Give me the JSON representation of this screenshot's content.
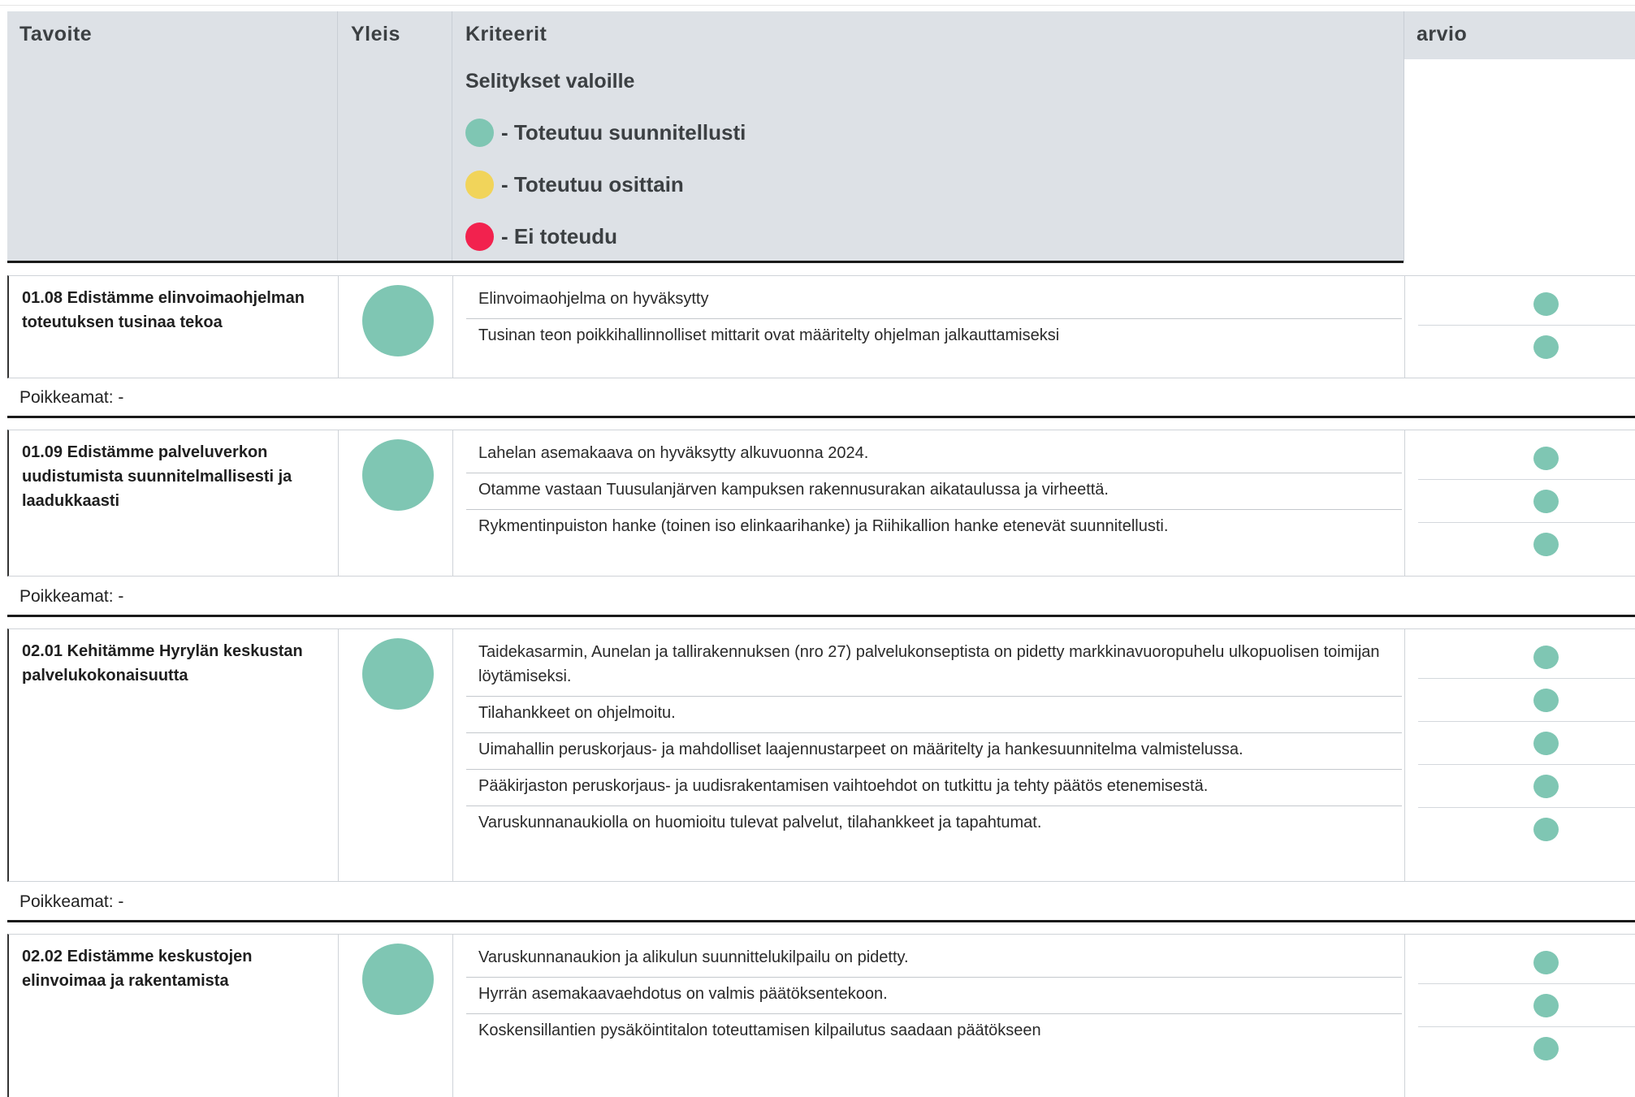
{
  "colors": {
    "green": "#7fc6b3",
    "yellow": "#f1d45a",
    "red": "#f2224e",
    "header_bg": "#dde1e6"
  },
  "header": {
    "tavoite": "Tavoite",
    "yleis": "Yleis",
    "kriteerit": "Kriteerit",
    "arvio": "arvio"
  },
  "legend": {
    "title": "Selitykset valoille",
    "items": [
      {
        "color": "green",
        "label": "- Toteutuu suunnitellusti"
      },
      {
        "color": "yellow",
        "label": "- Toteutuu osittain"
      },
      {
        "color": "red",
        "label": "- Ei toteudu"
      }
    ]
  },
  "goals": [
    {
      "title": "01.08 Edistämme elinvoimaohjelman toteutuksen tusinaa tekoa",
      "overall": "green",
      "criteria": [
        {
          "text": "Elinvoimaohjelma on hyväksytty",
          "status": "green"
        },
        {
          "text": "Tusinan teon poikkihallinnolliset mittarit ovat määritelty ohjelman jalkauttamiseksi",
          "status": "green"
        }
      ],
      "deviations": "Poikkeamat: -"
    },
    {
      "title": "01.09 Edistämme palveluverkon uudistumista suunnitelmallisesti ja laadukkaasti",
      "overall": "green",
      "criteria": [
        {
          "text": "Lahelan asemakaava on hyväksytty alkuvuonna 2024.",
          "status": "green"
        },
        {
          "text": "Otamme vastaan Tuusulanjärven kampuksen rakennusurakan aikataulussa ja virheettä.",
          "status": "green"
        },
        {
          "text": "Rykmentinpuiston hanke (toinen iso elinkaarihanke) ja Riihikallion hanke etenevät suunnitellusti.",
          "status": "green"
        }
      ],
      "deviations": "Poikkeamat: -"
    },
    {
      "title": "02.01 Kehitämme Hyrylän keskustan palvelukokonaisuutta",
      "overall": "green",
      "criteria": [
        {
          "text": "Taidekasarmin, Aunelan ja tallirakennuksen (nro 27) palvelukonseptista on pidetty markkinavuoropuhelu ulkopuolisen toimijan löytämiseksi.",
          "status": "green"
        },
        {
          "text": "Tilahankkeet on ohjelmoitu.",
          "status": "green"
        },
        {
          "text": "Uimahallin peruskorjaus- ja mahdolliset laajennustarpeet on  määritelty ja hankesuunnitelma valmistelussa.",
          "status": "green"
        },
        {
          "text": "Pääkirjaston peruskorjaus- ja uudisrakentamisen vaihtoehdot on tutkittu ja tehty päätös etenemisestä.",
          "status": "green"
        },
        {
          "text": "Varuskunnanaukiolla on huomioitu tulevat palvelut, tilahankkeet ja tapahtumat.",
          "status": "green"
        }
      ],
      "deviations": "Poikkeamat: -"
    },
    {
      "title": "02.02 Edistämme keskustojen elinvoimaa ja rakentamista",
      "overall": "green",
      "criteria": [
        {
          "text": "Varuskunnanaukion ja alikulun suunnittelukilpailu on pidetty.",
          "status": "green"
        },
        {
          "text": "Hyrrän asemakaavaehdotus on valmis päätöksentekoon.",
          "status": "green"
        },
        {
          "text": "Koskensillantien pysäköintitalon toteuttamisen kilpailutus saadaan päätökseen",
          "status": "green"
        }
      ],
      "deviations": ""
    }
  ]
}
